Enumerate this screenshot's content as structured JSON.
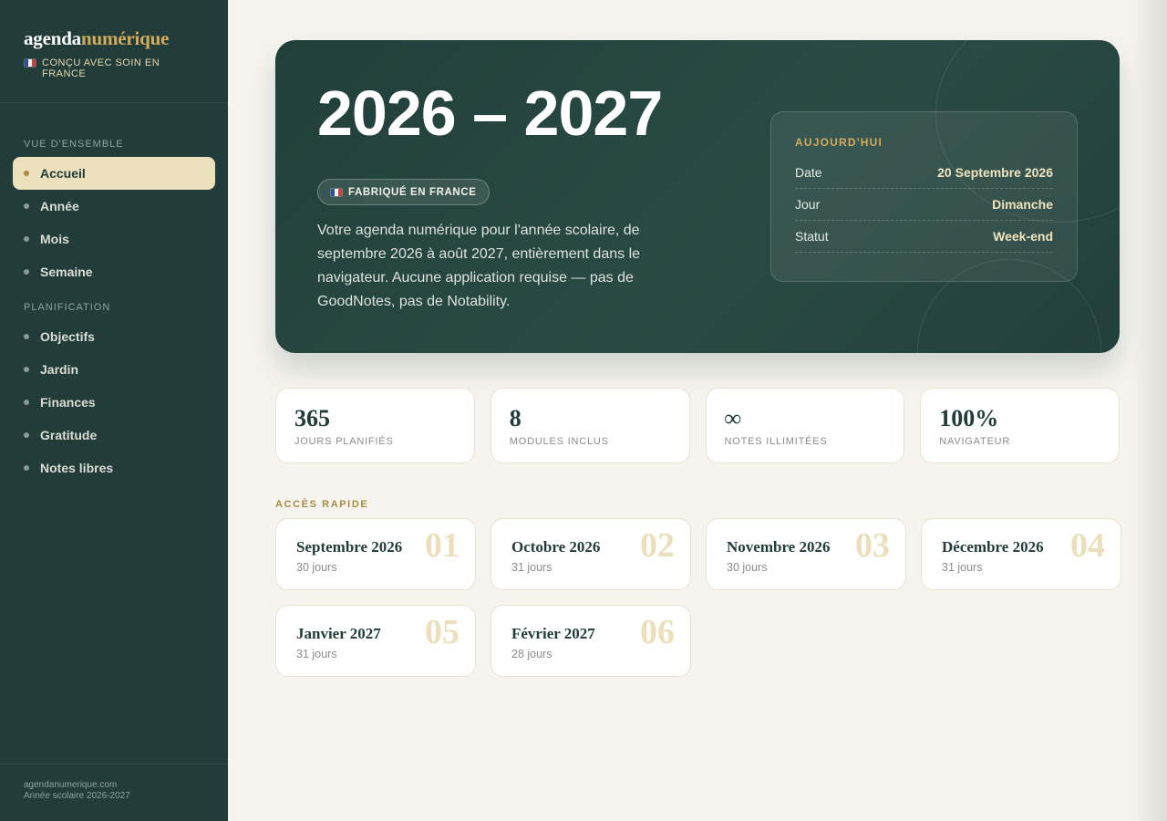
{
  "brand": {
    "name_part1": "agenda",
    "name_part2": "numérique",
    "tagline": "CONÇU AVEC SOIN EN FRANCE"
  },
  "sidebar": {
    "sections": [
      {
        "title": "VUE D'ENSEMBLE",
        "items": [
          {
            "label": "Accueil",
            "active": true
          },
          {
            "label": "Année"
          },
          {
            "label": "Mois"
          },
          {
            "label": "Semaine"
          }
        ]
      },
      {
        "title": "PLANIFICATION",
        "items": [
          {
            "label": "Objectifs"
          },
          {
            "label": "Jardin"
          },
          {
            "label": "Finances"
          },
          {
            "label": "Gratitude"
          },
          {
            "label": "Notes libres"
          }
        ]
      }
    ],
    "footer": {
      "line1": "agendanumerique.com",
      "line2": "Année scolaire 2026-2027"
    }
  },
  "hero": {
    "title": "2026 – 2027",
    "badge": "FABRIQUÉ EN FRANCE",
    "description": "Votre agenda numérique pour l'année scolaire, de septembre 2026 à août 2027, entièrement dans le navigateur. Aucune application requise — pas de GoodNotes, pas de Notability."
  },
  "today": {
    "title": "AUJOURD'HUI",
    "rows": [
      {
        "key": "Date",
        "value": "20 Septembre 2026"
      },
      {
        "key": "Jour",
        "value": "Dimanche"
      },
      {
        "key": "Statut",
        "value": "Week-end"
      }
    ]
  },
  "stats": [
    {
      "value": "365",
      "label": "JOURS PLANIFIÉS"
    },
    {
      "value": "8",
      "label": "MODULES INCLUS"
    },
    {
      "value": "∞",
      "label": "NOTES ILLIMITÉES"
    },
    {
      "value": "100%",
      "label": "NAVIGATEUR"
    }
  ],
  "quick_access": {
    "title": "ACCÈS RAPIDE",
    "months": [
      {
        "name": "Septembre 2026",
        "days": "30 jours",
        "number": "01"
      },
      {
        "name": "Octobre 2026",
        "days": "31 jours",
        "number": "02"
      },
      {
        "name": "Novembre 2026",
        "days": "30 jours",
        "number": "03"
      },
      {
        "name": "Décembre 2026",
        "days": "31 jours",
        "number": "04"
      },
      {
        "name": "Janvier 2027",
        "days": "31 jours",
        "number": "05"
      },
      {
        "name": "Février 2027",
        "days": "28 jours",
        "number": "06"
      }
    ]
  },
  "colors": {
    "sidebar_bg": "#213c39",
    "accent_gold": "#d3ac5c",
    "active_item_bg": "#ede1bd",
    "page_bg": "#f6f4ef"
  }
}
